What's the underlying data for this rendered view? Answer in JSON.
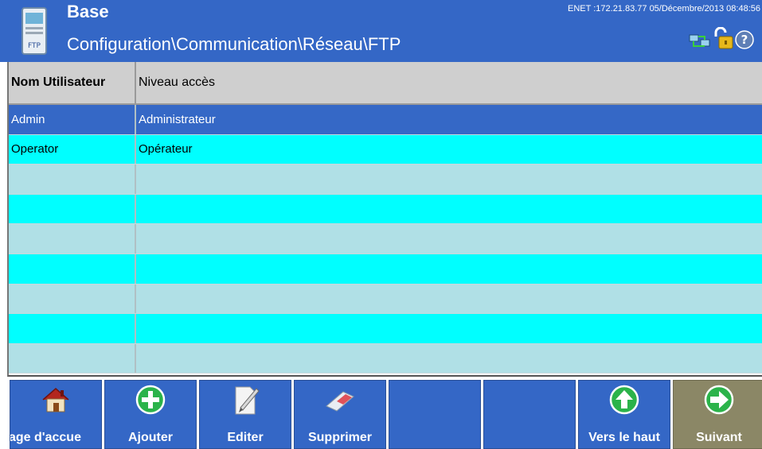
{
  "header": {
    "title": "Base",
    "path": "Configuration\\Communication\\Réseau\\FTP",
    "status": "ENET :172.21.83.77  05/Décembre/2013 08:48:56",
    "app_icon": "ftp-document-icon",
    "status_icons": [
      "network-icon",
      "unlocked-padlock-icon",
      "help-icon"
    ]
  },
  "table": {
    "columns": [
      "Nom Utilisateur",
      "Niveau accès"
    ],
    "rows": [
      {
        "user": "Admin",
        "level": "Administrateur",
        "selected": true
      },
      {
        "user": "Operator",
        "level": "Opérateur",
        "selected": false
      },
      {
        "user": "",
        "level": ""
      },
      {
        "user": "",
        "level": ""
      },
      {
        "user": "",
        "level": ""
      },
      {
        "user": "",
        "level": ""
      },
      {
        "user": "",
        "level": ""
      },
      {
        "user": "",
        "level": ""
      },
      {
        "user": "",
        "level": ""
      }
    ]
  },
  "toolbar": {
    "home_label": "age d'accue",
    "add_label": "Ajouter",
    "edit_label": "Editer",
    "delete_label": "Supprimer",
    "up_label": "Vers le haut",
    "next_label": "Suivant"
  },
  "colors": {
    "header_bg": "#3467c6",
    "selected_row": "#3568c6",
    "row_cyan": "#00ffff",
    "row_light": "#b0e0e6",
    "softkey_blue": "#3467c6",
    "softkey_tan": "#8b8766",
    "green_icon": "#2bb34a"
  }
}
